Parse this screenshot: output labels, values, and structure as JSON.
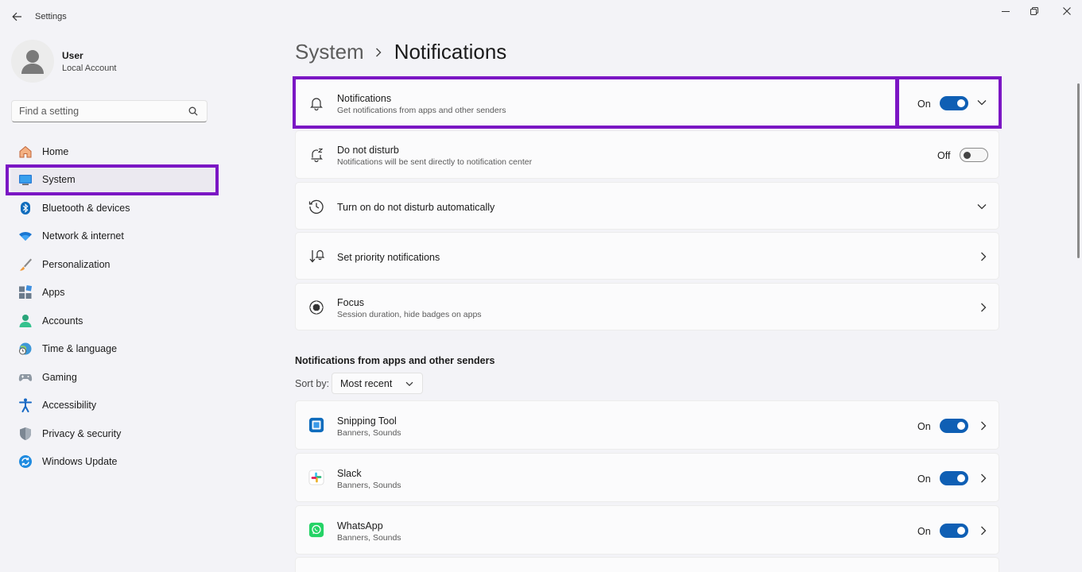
{
  "app": {
    "title": "Settings"
  },
  "profile": {
    "name": "User",
    "account_type": "Local Account"
  },
  "search": {
    "placeholder": "Find a setting"
  },
  "sidebar": {
    "items": [
      {
        "label": "Home",
        "icon": "home-icon"
      },
      {
        "label": "System",
        "icon": "system-icon",
        "active": true
      },
      {
        "label": "Bluetooth & devices",
        "icon": "bluetooth-icon"
      },
      {
        "label": "Network & internet",
        "icon": "wifi-icon"
      },
      {
        "label": "Personalization",
        "icon": "brush-icon"
      },
      {
        "label": "Apps",
        "icon": "apps-icon"
      },
      {
        "label": "Accounts",
        "icon": "accounts-icon"
      },
      {
        "label": "Time & language",
        "icon": "globe-clock-icon"
      },
      {
        "label": "Gaming",
        "icon": "gamepad-icon"
      },
      {
        "label": "Accessibility",
        "icon": "accessibility-icon"
      },
      {
        "label": "Privacy & security",
        "icon": "shield-icon"
      },
      {
        "label": "Windows Update",
        "icon": "update-icon"
      }
    ]
  },
  "breadcrumb": {
    "parent": "System",
    "current": "Notifications"
  },
  "settings": {
    "notifications": {
      "title": "Notifications",
      "subtitle": "Get notifications from apps and other senders",
      "state": "On",
      "icon": "bell-icon"
    },
    "do_not_disturb": {
      "title": "Do not disturb",
      "subtitle": "Notifications will be sent directly to notification center",
      "state": "Off",
      "icon": "bell-snooze-icon"
    },
    "dnd_auto": {
      "title": "Turn on do not disturb automatically",
      "icon": "clock-icon"
    },
    "priority": {
      "title": "Set priority notifications",
      "icon": "priority-icon"
    },
    "focus": {
      "title": "Focus",
      "subtitle": "Session duration, hide badges on apps",
      "icon": "focus-icon"
    }
  },
  "apps_section": {
    "title": "Notifications from apps and other senders",
    "sort_label": "Sort by:",
    "sort_value": "Most recent",
    "apps": [
      {
        "name": "Snipping Tool",
        "detail": "Banners, Sounds",
        "state": "On",
        "icon": "snipping-tool-icon",
        "color": "#0f6cbd"
      },
      {
        "name": "Slack",
        "detail": "Banners, Sounds",
        "state": "On",
        "icon": "slack-icon",
        "color": "#4a154b"
      },
      {
        "name": "WhatsApp",
        "detail": "Banners, Sounds",
        "state": "On",
        "icon": "whatsapp-icon",
        "color": "#25d366"
      }
    ]
  },
  "colors": {
    "accent": "#0f5fb4",
    "highlight": "#7b16c4"
  }
}
